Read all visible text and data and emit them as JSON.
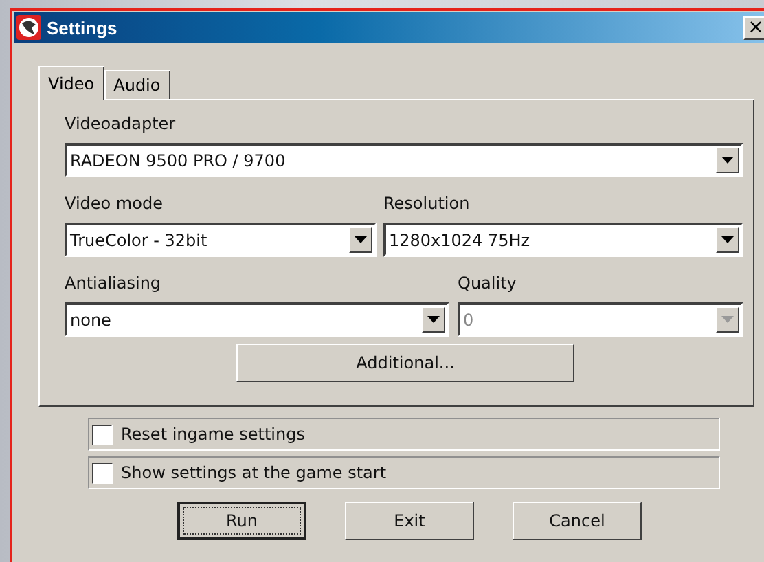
{
  "window": {
    "title": "Settings",
    "close": "×"
  },
  "tabs": [
    {
      "label": "Video",
      "selected": true
    },
    {
      "label": "Audio",
      "selected": false
    }
  ],
  "videoadapter": {
    "label": "Videoadapter",
    "value": "RADEON 9500 PRO / 9700",
    "disabled": false
  },
  "video_mode": {
    "label": "Video mode",
    "value": "TrueColor - 32bit",
    "disabled": false
  },
  "resolution": {
    "label": "Resolution",
    "value": "1280x1024 75Hz",
    "disabled": false
  },
  "antialiasing": {
    "label": "Antialiasing",
    "value": "none",
    "disabled": false
  },
  "quality": {
    "label": "Quality",
    "value": "0",
    "disabled": true
  },
  "additional_button": "Additional...",
  "checkboxes": [
    {
      "label": "Reset ingame settings",
      "checked": false
    },
    {
      "label": "Show settings at the game start",
      "checked": false
    }
  ],
  "buttons": [
    {
      "label": "Run",
      "default": true
    },
    {
      "label": "Exit",
      "default": false
    },
    {
      "label": "Cancel",
      "default": false
    }
  ]
}
